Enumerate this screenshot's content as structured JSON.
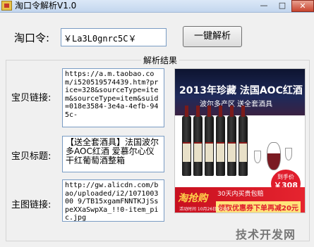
{
  "window": {
    "title": "淘口令解析V1.0",
    "minimize_label": "—",
    "maximize_label": "□",
    "close_label": "✕"
  },
  "form": {
    "taokou_label": "淘口令:",
    "taokou_value": "￥La3L0gnrc5C￥",
    "parse_button": "一键解析"
  },
  "results": {
    "group_title": "解析结果",
    "link_label": "宝贝链接:",
    "link_value": "https://a.m.taobao.com/i520519574439.htm?price=328&sourceType=item&sourceType=item&suid=018e3584-3e4a-4efb-945c-",
    "title_label": "宝贝标题:",
    "title_value": "【送全套酒具】法国波尔多AOC红酒 爱慕尔心仪干红葡萄酒整箱",
    "image_label": "主图链接:",
    "image_value": "http://gw.alicdn.com/bao/uploaded/i2/107100300 9/TB15xgamFNNTKJjSspeXXaSwpXa_!!0-item_pic.jpg"
  },
  "product_image": {
    "headline": "2013年珍藏 法国AOC红酒",
    "subline": "波尔多产区 送全套酒具",
    "price_badge_top": "到手价",
    "price_badge_price": "￥308元",
    "promo_logo": "淘抢购",
    "promo_line1": "30天内买贵包赔",
    "promo_line2": "领取优惠券下单再减20元",
    "promo_date": "活动时间 10月26日17:00"
  },
  "watermark": "技术开发网"
}
